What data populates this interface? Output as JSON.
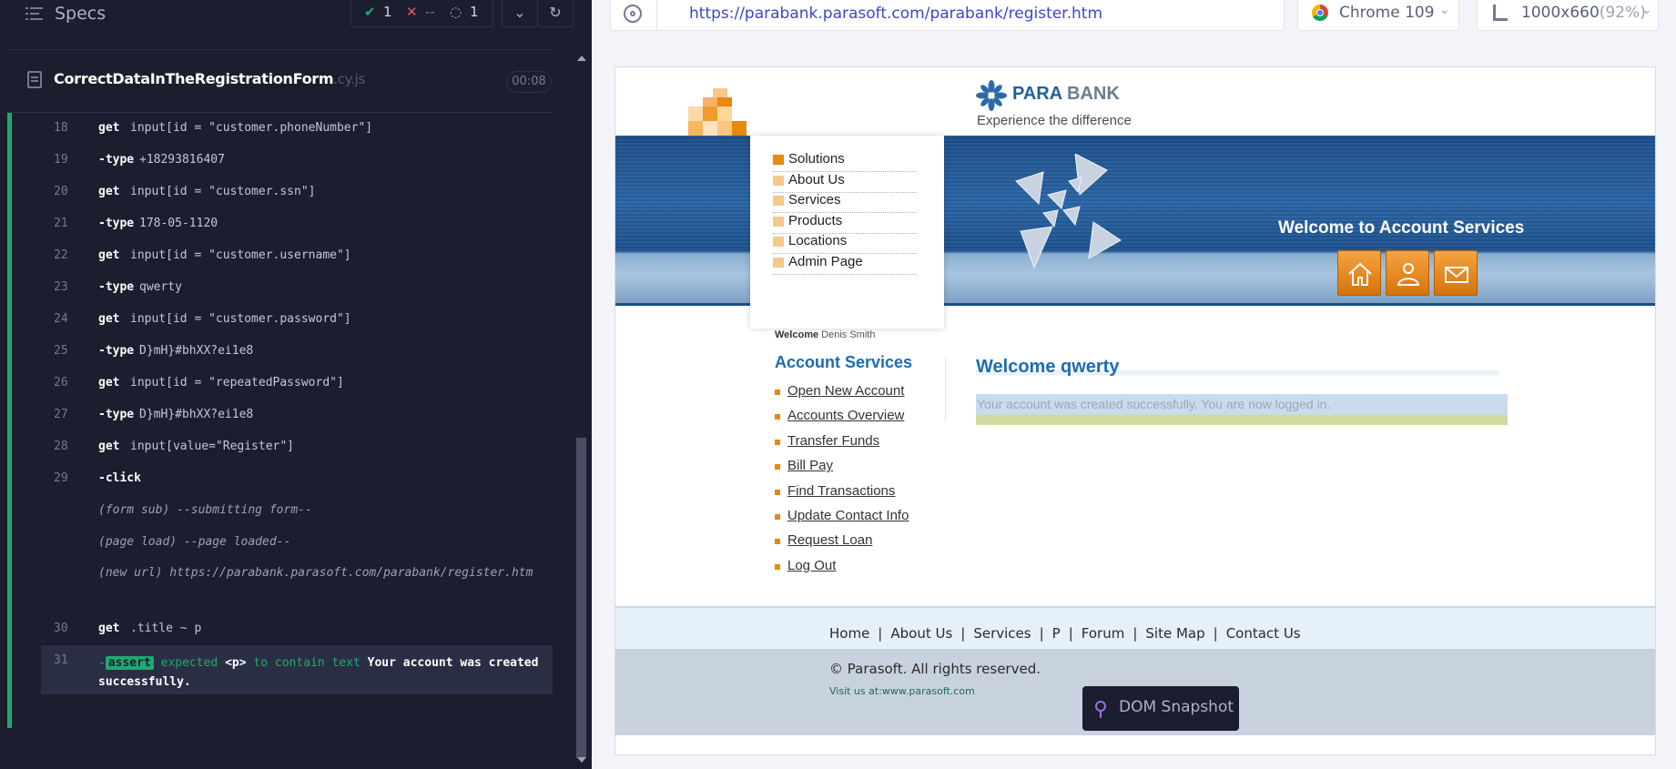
{
  "specs": {
    "title": "Specs",
    "passed": "1",
    "failed": "--",
    "pending": "1"
  },
  "spec_file": {
    "name": "CorrectDataInTheRegistrationForm",
    "ext": ".cy.js",
    "duration": "00:08"
  },
  "log": [
    {
      "n": "18",
      "cmd": "get",
      "arg": "input[id = \"customer.phoneNumber\"]"
    },
    {
      "n": "19",
      "cmd": "-type",
      "arg": "+18293816407"
    },
    {
      "n": "20",
      "cmd": "get",
      "arg": "input[id = \"customer.ssn\"]"
    },
    {
      "n": "21",
      "cmd": "-type",
      "arg": "178-05-1120"
    },
    {
      "n": "22",
      "cmd": "get",
      "arg": "input[id = \"customer.username\"]"
    },
    {
      "n": "23",
      "cmd": "-type",
      "arg": "qwerty"
    },
    {
      "n": "24",
      "cmd": "get",
      "arg": "input[id = \"customer.password\"]"
    },
    {
      "n": "25",
      "cmd": "-type",
      "arg": "D}mH}#bhXX?ei1e8"
    },
    {
      "n": "26",
      "cmd": "get",
      "arg": "input[id = \"repeatedPassword\"]"
    },
    {
      "n": "27",
      "cmd": "-type",
      "arg": "D}mH}#bhXX?ei1e8"
    },
    {
      "n": "28",
      "cmd": "get",
      "arg": "input[value=\"Register\"]"
    },
    {
      "n": "29",
      "cmd": "-click",
      "arg": ""
    }
  ],
  "events": {
    "form_sub": "(form sub)  --submitting form--",
    "page_load": "(page load)  --page loaded--",
    "new_url": "(new url)  https://parabank.parasoft.com/parabank/register.htm"
  },
  "log30": {
    "n": "30",
    "cmd": "get",
    "arg": ".title ~ p"
  },
  "log31": {
    "n": "31",
    "badge": "assert",
    "pre": "expected",
    "tag": "<p>",
    "mid": "to contain text",
    "text": "Your account was created successfully."
  },
  "browser": {
    "url": "https://parabank.parasoft.com/parabank/register.htm",
    "name": "Chrome 109",
    "viewport": "1000x660",
    "zoom": "(92%)"
  },
  "site": {
    "bank_name_1": "PARA",
    "bank_name_2": "BANK",
    "tagline": "Experience the difference",
    "nav": [
      "Solutions",
      "About Us",
      "Services",
      "Products",
      "Locations",
      "Admin Page"
    ],
    "banner_title": "Welcome to Account Services",
    "welcome_label": "Welcome",
    "welcome_name": "Denis Smith",
    "account_services_title": "Account Services",
    "account_links": [
      "Open New Account",
      "Accounts Overview",
      "Transfer Funds",
      "Bill Pay",
      "Find Transactions",
      "Update Contact Info",
      "Request Loan",
      "Log Out"
    ],
    "welcome_heading": "Welcome qwerty",
    "success_message": "Your account was created successfully. You are now logged in.",
    "footer_links": [
      "Home",
      "About Us",
      "Services",
      "P",
      "Forum",
      "Site Map",
      "Contact Us"
    ],
    "copyright": "© Parasoft. All rights reserved.",
    "visit": "Visit us at:www.parasoft.com"
  },
  "tooltip": {
    "label": "DOM Snapshot"
  },
  "colors": {
    "pass": "#1fa971",
    "brand_blue": "#1e6bb0",
    "orange": "#e8880c",
    "panel_bg": "#1b1e2e"
  }
}
